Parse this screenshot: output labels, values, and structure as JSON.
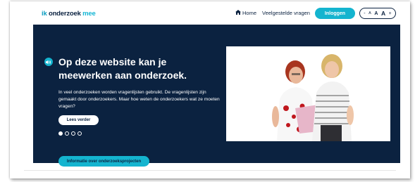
{
  "header": {
    "logo": {
      "part1": "ik ",
      "part2": "onderzoek",
      "part3": " mee"
    },
    "nav": {
      "home_label": "Home",
      "faq_label": "Veelgestelde vragen"
    },
    "login_label": "Inloggen",
    "font_controls": {
      "minus": "-",
      "a_small": "A",
      "a_medium": "A",
      "a_large": "A",
      "plus": "+"
    }
  },
  "hero": {
    "headline": "Op deze website kan je meewerken aan onderzoek.",
    "body": "In veel onderzoeken worden vragenlijsten gebruikt. De vragenlijsten zijn gemaakt door onderzoekers. Maar hoe weten de onderzoekers wat ze moeten vragen?",
    "read_more_label": "Lees verder",
    "slides": {
      "count": 4,
      "active": 1
    }
  },
  "info_button_label": "Informatie over onderzoeksprojecten",
  "colors": {
    "navy": "#0b2240",
    "accent": "#14b4cf"
  },
  "icons": [
    "home-icon",
    "speaker-icon"
  ]
}
